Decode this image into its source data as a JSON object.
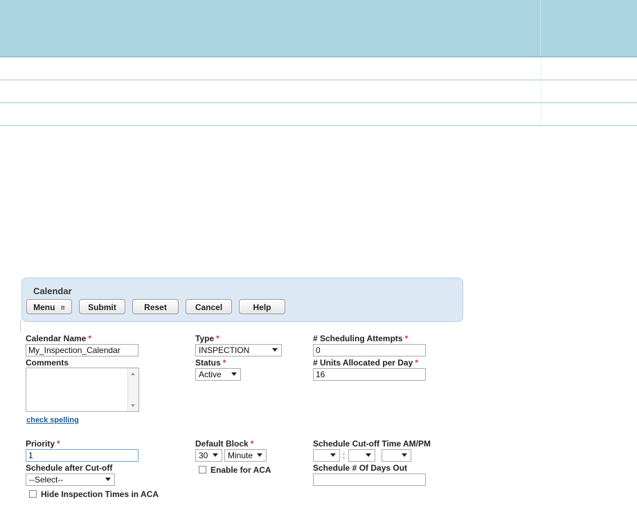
{
  "toolbar": {
    "title": "Calendar",
    "menu_label": "Menu",
    "submit_label": "Submit",
    "reset_label": "Reset",
    "cancel_label": "Cancel",
    "help_label": "Help"
  },
  "form": {
    "calendar_name_label": "Calendar Name",
    "calendar_name_value": "My_Inspection_Calendar",
    "comments_label": "Comments",
    "check_spelling": "check spelling",
    "type_label": "Type",
    "type_value": "INSPECTION",
    "status_label": "Status",
    "status_value": "Active",
    "scheduling_attempts_label": "# Scheduling Attempts",
    "scheduling_attempts_value": "0",
    "units_allocated_label": "# Units Allocated per Day",
    "units_allocated_value": "16",
    "priority_label": "Priority",
    "priority_value": "1",
    "schedule_after_cutoff_label": "Schedule after Cut-off",
    "schedule_after_cutoff_value": "--Select--",
    "hide_inspection_label": "Hide Inspection Times in ACA",
    "default_block_label": "Default Block",
    "default_block_value": "30",
    "default_block_unit": "Minute",
    "enable_aca_label": "Enable for ACA",
    "cutoff_time_label": "Schedule Cut-off Time  AM/PM",
    "cutoff_colon": ":",
    "days_out_label": "Schedule # Of Days Out",
    "required_mark": "*"
  }
}
